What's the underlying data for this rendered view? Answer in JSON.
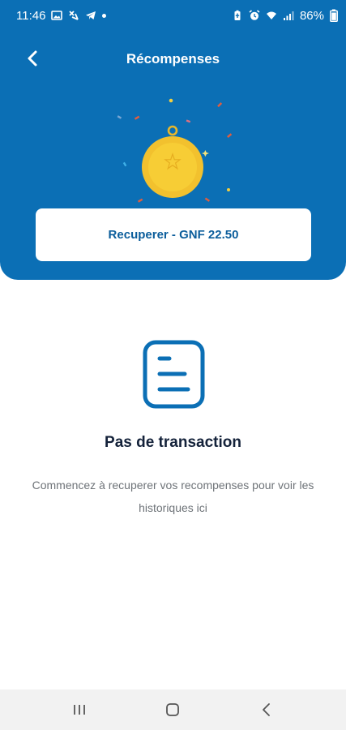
{
  "status_bar": {
    "time": "11:46",
    "battery": "86%",
    "icons_left": [
      "gallery-icon",
      "missed-call-icon",
      "telegram-icon",
      "dot-icon"
    ],
    "icons_right": [
      "battery-saver-icon",
      "alarm-icon",
      "wifi-icon",
      "signal-icon"
    ]
  },
  "header": {
    "title": "Récompenses",
    "back_icon": "chevron-left-icon",
    "background_color": "#0b6fb5",
    "illustration": "medal-icon"
  },
  "redeem": {
    "label": "Recuperer - GNF 22.50"
  },
  "empty_state": {
    "icon": "document-lines-icon",
    "title": "Pas de transaction",
    "description": "Commencez à recuperer vos recompenses pour voir les historiques ici"
  },
  "nav_bar": {
    "items": [
      "recent-apps-icon",
      "home-icon",
      "back-icon"
    ]
  }
}
